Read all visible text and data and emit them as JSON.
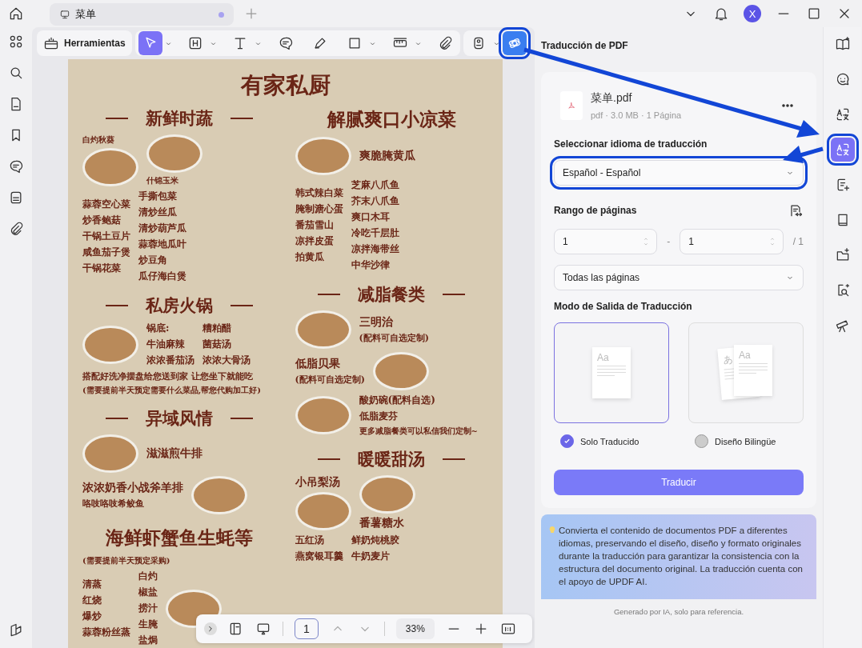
{
  "titlebar": {
    "tab": {
      "label": "菜单",
      "unsaved": true
    },
    "avatar": "X"
  },
  "left_rail": [
    {
      "kind": "grid"
    },
    {
      "kind": "search"
    },
    {
      "kind": "page"
    },
    {
      "kind": "bookmark"
    },
    {
      "kind": "comment"
    },
    {
      "kind": "stack"
    },
    {
      "kind": "clip"
    }
  ],
  "left_rail_bottom": {
    "kind": "layers"
  },
  "toolbar": {
    "tools_button": "Herramientas",
    "groups": [
      [
        {
          "kind": "cursor",
          "caret": true,
          "selected": true,
          "highlighted": false
        },
        {
          "kind": "heading",
          "caret": true,
          "selected": false,
          "highlighted": false
        },
        {
          "kind": "text",
          "caret": true,
          "selected": false,
          "highlighted": false
        },
        {
          "kind": "comment",
          "caret": false,
          "selected": false,
          "highlighted": false
        },
        {
          "kind": "pen",
          "caret": false,
          "selected": false,
          "highlighted": false
        },
        {
          "kind": "rect",
          "caret": true,
          "selected": false,
          "highlighted": false
        },
        {
          "kind": "measure",
          "caret": true,
          "selected": false,
          "highlighted": false
        },
        {
          "kind": "clip",
          "caret": false,
          "selected": false,
          "highlighted": false
        }
      ],
      [
        {
          "kind": "stamp",
          "caret": true,
          "selected": false,
          "highlighted": false
        },
        {
          "kind": "ai",
          "caret": false,
          "selected": false,
          "highlighted": true
        }
      ]
    ]
  },
  "menu": {
    "title": "有家私厨",
    "columns": [
      [
        {
          "heading": "新鲜时蔬",
          "ruled": true,
          "rows": [
            [
              {
                "parts": [
                  {
                    "kind": "small",
                    "text": "白灼秋葵"
                  },
                  {
                    "kind": "photo"
                  }
                ]
              },
              {
                "parts": [
                  {
                    "kind": "photo"
                  },
                  {
                    "kind": "small",
                    "text": "什锦玉米"
                  }
                ]
              }
            ],
            [
              {
                "parts": [
                  {
                    "kind": "item",
                    "text": "蒜蓉空心菜"
                  },
                  {
                    "kind": "item",
                    "text": "炒香鲍菇"
                  },
                  {
                    "kind": "item",
                    "text": "干锅土豆片"
                  },
                  {
                    "kind": "item",
                    "text": "咸鱼茄子煲"
                  },
                  {
                    "kind": "item",
                    "text": "干锅花菜"
                  }
                ]
              },
              {
                "parts": [
                  {
                    "kind": "item",
                    "text": "手撕包菜"
                  },
                  {
                    "kind": "item",
                    "text": "清炒丝瓜"
                  },
                  {
                    "kind": "item",
                    "text": "清炒葫芦瓜"
                  },
                  {
                    "kind": "item",
                    "text": "蒜蓉地瓜叶"
                  },
                  {
                    "kind": "item",
                    "text": "炒豆角"
                  },
                  {
                    "kind": "item",
                    "text": "瓜仔海白煲"
                  }
                ]
              }
            ]
          ]
        },
        {
          "heading": "私房火锅",
          "ruled": true,
          "rows": [
            [
              {
                "parts": [
                  {
                    "kind": "photo"
                  }
                ]
              },
              {
                "parts": [
                  {
                    "kind": "item",
                    "text": "锅底:"
                  },
                  {
                    "kind": "item",
                    "text": "牛油麻辣"
                  },
                  {
                    "kind": "item",
                    "text": "浓浓番茄汤"
                  }
                ]
              },
              {
                "parts": [
                  {
                    "kind": "item",
                    "text": "糟粕醋"
                  },
                  {
                    "kind": "item",
                    "text": "菌菇汤"
                  },
                  {
                    "kind": "item",
                    "text": "浓浓大骨汤"
                  }
                ]
              }
            ],
            [
              {
                "parts": [
                  {
                    "kind": "note",
                    "text": "搭配好洗净摆盘给您送到家 让您坐下就能吃"
                  },
                  {
                    "kind": "small",
                    "text": "(需要提前半天预定需要什么菜品,帮您代购加工好)"
                  }
                ]
              }
            ]
          ]
        },
        {
          "heading": "异域风情",
          "ruled": true,
          "rows": [
            [
              {
                "parts": [
                  {
                    "kind": "photo"
                  }
                ]
              },
              {
                "parts": [
                  {
                    "kind": "label",
                    "text": "滋滋煎牛排"
                  }
                ]
              }
            ],
            [
              {
                "parts": [
                  {
                    "kind": "label",
                    "text": "浓浓奶香小战斧羊排"
                  },
                  {
                    "kind": "note",
                    "text": "咯吱咯吱希鲛鱼"
                  }
                ]
              },
              {
                "parts": [
                  {
                    "kind": "photo"
                  }
                ]
              }
            ]
          ]
        },
        {
          "heading": "海鲜虾蟹鱼生蚝等",
          "ruled": false,
          "rows": [
            [
              {
                "parts": [
                  {
                    "kind": "small",
                    "text": "(需要提前半天预定采购)"
                  }
                ]
              }
            ],
            [
              {
                "parts": [
                  {
                    "kind": "item",
                    "text": "清蒸"
                  },
                  {
                    "kind": "item",
                    "text": "红烧"
                  },
                  {
                    "kind": "item",
                    "text": "爆炒"
                  },
                  {
                    "kind": "item",
                    "text": "蒜蓉粉丝蒸"
                  }
                ]
              },
              {
                "parts": [
                  {
                    "kind": "item",
                    "text": "白灼"
                  },
                  {
                    "kind": "item",
                    "text": "椒盐"
                  },
                  {
                    "kind": "item",
                    "text": "捞汁"
                  },
                  {
                    "kind": "item",
                    "text": "生腌"
                  },
                  {
                    "kind": "item",
                    "text": "盐焗"
                  }
                ]
              },
              {
                "parts": [
                  {
                    "kind": "photo"
                  }
                ]
              }
            ]
          ]
        }
      ],
      [
        {
          "heading": "解腻爽口小凉菜",
          "ruled": false,
          "rows": [
            [
              {
                "parts": [
                  {
                    "kind": "photo"
                  }
                ]
              },
              {
                "parts": [
                  {
                    "kind": "label",
                    "text": "爽脆腌黄瓜"
                  }
                ]
              }
            ],
            [
              {
                "parts": [
                  {
                    "kind": "item",
                    "text": "韩式辣白菜"
                  },
                  {
                    "kind": "item",
                    "text": "腌制溏心蛋"
                  },
                  {
                    "kind": "item",
                    "text": "番茄雪山"
                  },
                  {
                    "kind": "item",
                    "text": "凉拌皮蛋"
                  },
                  {
                    "kind": "item",
                    "text": "拍黄瓜"
                  }
                ]
              },
              {
                "parts": [
                  {
                    "kind": "item",
                    "text": "芝麻八爪鱼"
                  },
                  {
                    "kind": "item",
                    "text": "芥末八爪鱼"
                  },
                  {
                    "kind": "item",
                    "text": "爽口木耳"
                  },
                  {
                    "kind": "item",
                    "text": "冷吃千层肚"
                  },
                  {
                    "kind": "item",
                    "text": "凉拌海带丝"
                  },
                  {
                    "kind": "item",
                    "text": "中华沙律"
                  }
                ]
              }
            ]
          ]
        },
        {
          "heading": "减脂餐类",
          "ruled": true,
          "rows": [
            [
              {
                "parts": [
                  {
                    "kind": "photo"
                  }
                ]
              },
              {
                "parts": [
                  {
                    "kind": "label",
                    "text": "三明治"
                  },
                  {
                    "kind": "note",
                    "text": "(配料可自选定制)"
                  }
                ]
              }
            ],
            [
              {
                "parts": [
                  {
                    "kind": "label",
                    "text": "低脂贝果"
                  },
                  {
                    "kind": "note",
                    "text": "(配料可自选定制)"
                  }
                ]
              },
              {
                "parts": [
                  {
                    "kind": "photo"
                  }
                ]
              }
            ],
            [
              {
                "parts": [
                  {
                    "kind": "photo"
                  }
                ]
              },
              {
                "parts": [
                  {
                    "kind": "item",
                    "text": "酸奶碗(配料自选)"
                  },
                  {
                    "kind": "item",
                    "text": "低脂麦芬"
                  },
                  {
                    "kind": "small",
                    "text": "更多减脂餐类可以私信我们定制~"
                  }
                ]
              }
            ]
          ]
        },
        {
          "heading": "暖暖甜汤",
          "ruled": true,
          "rows": [
            [
              {
                "parts": [
                  {
                    "kind": "label",
                    "text": "小吊梨汤"
                  },
                  {
                    "kind": "photo"
                  }
                ]
              },
              {
                "parts": [
                  {
                    "kind": "photo"
                  },
                  {
                    "kind": "label",
                    "text": "番薯糖水"
                  }
                ]
              }
            ],
            [
              {
                "parts": [
                  {
                    "kind": "item",
                    "text": "五红汤"
                  },
                  {
                    "kind": "item",
                    "text": "燕窝银耳羹"
                  }
                ]
              },
              {
                "parts": [
                  {
                    "kind": "item",
                    "text": "鲜奶炖桃胶"
                  },
                  {
                    "kind": "item",
                    "text": "牛奶麦片"
                  }
                ]
              }
            ]
          ]
        }
      ]
    ]
  },
  "page_nav": {
    "page": "1",
    "zoom": "33%"
  },
  "panel": {
    "title": "Traducción de PDF",
    "file": {
      "name": "菜单.pdf",
      "meta": "pdf · 3.0 MB · 1 Página"
    },
    "language": {
      "label": "Seleccionar idioma de traducción",
      "value": "Español - Español",
      "highlighted": true
    },
    "range": {
      "label": "Rango de páginas",
      "from": "1",
      "separator": "-",
      "to": "1",
      "total": "/ 1",
      "preset": "Todas las páginas"
    },
    "mode": {
      "label": "Modo de Salida de Traducción",
      "options": [
        {
          "kind": "single",
          "label": "Solo Traducido",
          "selected": true,
          "preview": [
            "Aa"
          ]
        },
        {
          "kind": "bilingual",
          "label": "Diseño Bilingüe",
          "selected": false,
          "preview": [
            "あ",
            "Aa"
          ]
        }
      ]
    },
    "button": "Traducir",
    "info": "Convierta el contenido de documentos PDF a diferentes idiomas, preservando el diseño, diseño y formato originales durante la traducción para garantizar la consistencia con la estructura del documento original. La traducción cuenta con el apoyo de UPDF AI.",
    "footer": "Generado por IA, solo para referencia."
  },
  "right_rail": [
    {
      "kind": "book-spark",
      "selected": false,
      "highlighted": false
    },
    {
      "kind": "chat-face",
      "selected": false,
      "highlighted": false
    },
    {
      "kind": "translate",
      "selected": false,
      "highlighted": false
    },
    {
      "kind": "translate",
      "selected": true,
      "highlighted": true
    },
    {
      "kind": "doc-spark",
      "selected": false,
      "highlighted": false
    },
    {
      "kind": "book",
      "selected": false,
      "highlighted": false
    },
    {
      "kind": "folder-spark",
      "selected": false,
      "highlighted": false
    },
    {
      "kind": "search-spark",
      "selected": false,
      "highlighted": false
    },
    {
      "kind": "telescope",
      "selected": false,
      "highlighted": false
    }
  ]
}
